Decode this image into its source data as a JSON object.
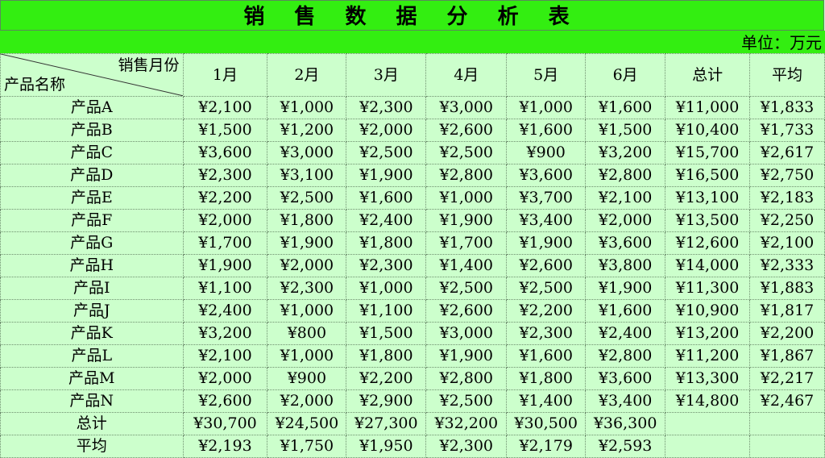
{
  "title": "销 售 数 据 分 析 表",
  "unit_label": "单位：万元",
  "corner": {
    "top": "销售月份",
    "bottom": "产品名称"
  },
  "columns": [
    "1月",
    "2月",
    "3月",
    "4月",
    "5月",
    "6月",
    "总计",
    "平均"
  ],
  "rows": [
    {
      "name": "产品A",
      "values": [
        "¥2,100",
        "¥1,000",
        "¥2,300",
        "¥3,000",
        "¥1,000",
        "¥1,600",
        "¥11,000",
        "¥1,833"
      ]
    },
    {
      "name": "产品B",
      "values": [
        "¥1,500",
        "¥1,200",
        "¥2,000",
        "¥2,600",
        "¥1,600",
        "¥1,500",
        "¥10,400",
        "¥1,733"
      ]
    },
    {
      "name": "产品C",
      "values": [
        "¥3,600",
        "¥3,000",
        "¥2,500",
        "¥2,500",
        "¥900",
        "¥3,200",
        "¥15,700",
        "¥2,617"
      ]
    },
    {
      "name": "产品D",
      "values": [
        "¥2,300",
        "¥3,100",
        "¥1,900",
        "¥2,800",
        "¥3,600",
        "¥2,800",
        "¥16,500",
        "¥2,750"
      ]
    },
    {
      "name": "产品E",
      "values": [
        "¥2,200",
        "¥2,500",
        "¥1,600",
        "¥1,000",
        "¥3,700",
        "¥2,100",
        "¥13,100",
        "¥2,183"
      ]
    },
    {
      "name": "产品F",
      "values": [
        "¥2,000",
        "¥1,800",
        "¥2,400",
        "¥1,900",
        "¥3,400",
        "¥2,000",
        "¥13,500",
        "¥2,250"
      ]
    },
    {
      "name": "产品G",
      "values": [
        "¥1,700",
        "¥1,900",
        "¥1,800",
        "¥1,700",
        "¥1,900",
        "¥3,600",
        "¥12,600",
        "¥2,100"
      ]
    },
    {
      "name": "产品H",
      "values": [
        "¥1,900",
        "¥2,000",
        "¥2,300",
        "¥1,400",
        "¥2,600",
        "¥3,800",
        "¥14,000",
        "¥2,333"
      ]
    },
    {
      "name": "产品I",
      "values": [
        "¥1,100",
        "¥2,300",
        "¥1,000",
        "¥2,500",
        "¥2,500",
        "¥1,900",
        "¥11,300",
        "¥1,883"
      ]
    },
    {
      "name": "产品J",
      "values": [
        "¥2,400",
        "¥1,000",
        "¥1,100",
        "¥2,600",
        "¥2,200",
        "¥1,600",
        "¥10,900",
        "¥1,817"
      ]
    },
    {
      "name": "产品K",
      "values": [
        "¥3,200",
        "¥800",
        "¥1,500",
        "¥3,000",
        "¥2,300",
        "¥2,400",
        "¥13,200",
        "¥2,200"
      ]
    },
    {
      "name": "产品L",
      "values": [
        "¥2,100",
        "¥1,000",
        "¥1,800",
        "¥1,900",
        "¥1,600",
        "¥2,800",
        "¥11,200",
        "¥1,867"
      ]
    },
    {
      "name": "产品M",
      "values": [
        "¥2,000",
        "¥900",
        "¥2,200",
        "¥2,800",
        "¥1,800",
        "¥3,600",
        "¥13,300",
        "¥2,217"
      ]
    },
    {
      "name": "产品N",
      "values": [
        "¥2,600",
        "¥2,000",
        "¥2,900",
        "¥2,500",
        "¥1,400",
        "¥3,400",
        "¥14,800",
        "¥2,467"
      ]
    },
    {
      "name": "总计",
      "values": [
        "¥30,700",
        "¥24,500",
        "¥27,300",
        "¥32,200",
        "¥30,500",
        "¥36,300",
        "",
        ""
      ]
    },
    {
      "name": "平均",
      "values": [
        "¥2,193",
        "¥1,750",
        "¥1,950",
        "¥2,300",
        "¥2,179",
        "¥2,593",
        "",
        ""
      ]
    }
  ],
  "colors": {
    "title_bg": "#33ee11",
    "sheet_bg": "#ccffcc",
    "grid_line": "#6f8f6f"
  }
}
